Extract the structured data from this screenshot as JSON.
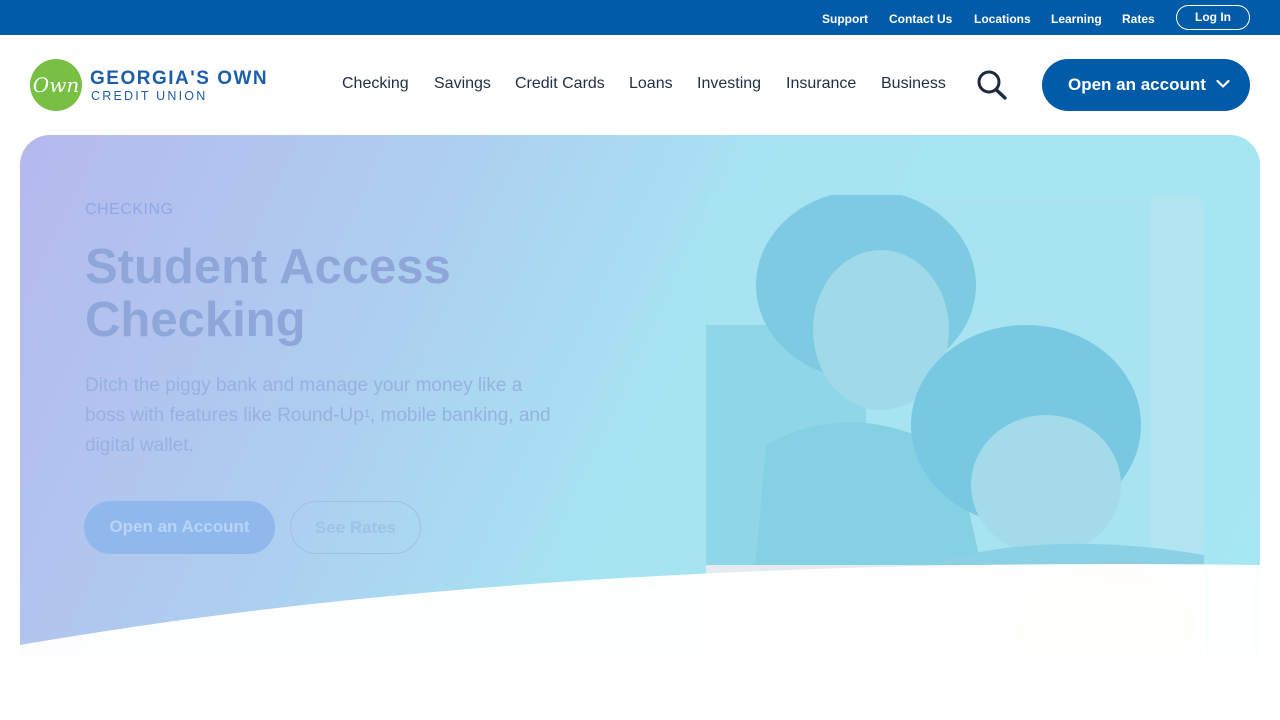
{
  "utility_nav": {
    "links": [
      "Support",
      "Contact Us",
      "Locations",
      "Learning",
      "Rates"
    ],
    "login_label": "Log In"
  },
  "brand": {
    "logo_script": "Own",
    "name": "GEORGIA'S OWN",
    "subtitle": "CREDIT UNION"
  },
  "main_nav": {
    "items": [
      "Checking",
      "Savings",
      "Credit Cards",
      "Loans",
      "Investing",
      "Insurance",
      "Business"
    ],
    "search_icon": "search-icon",
    "cta_label": "Open an account"
  },
  "hero": {
    "eyebrow": "CHECKING",
    "title": "Student Access Checking",
    "description_before": "Ditch the piggy bank and manage your money like a boss with features like Round-Up",
    "footnote": "1",
    "description_after": ", mobile banking, and digital wallet.",
    "primary_button": "Open an Account",
    "secondary_button": "See Rates"
  },
  "colors": {
    "brand_blue": "#015ba8",
    "brand_green": "#77c044",
    "nav_text": "#1f2e45"
  }
}
